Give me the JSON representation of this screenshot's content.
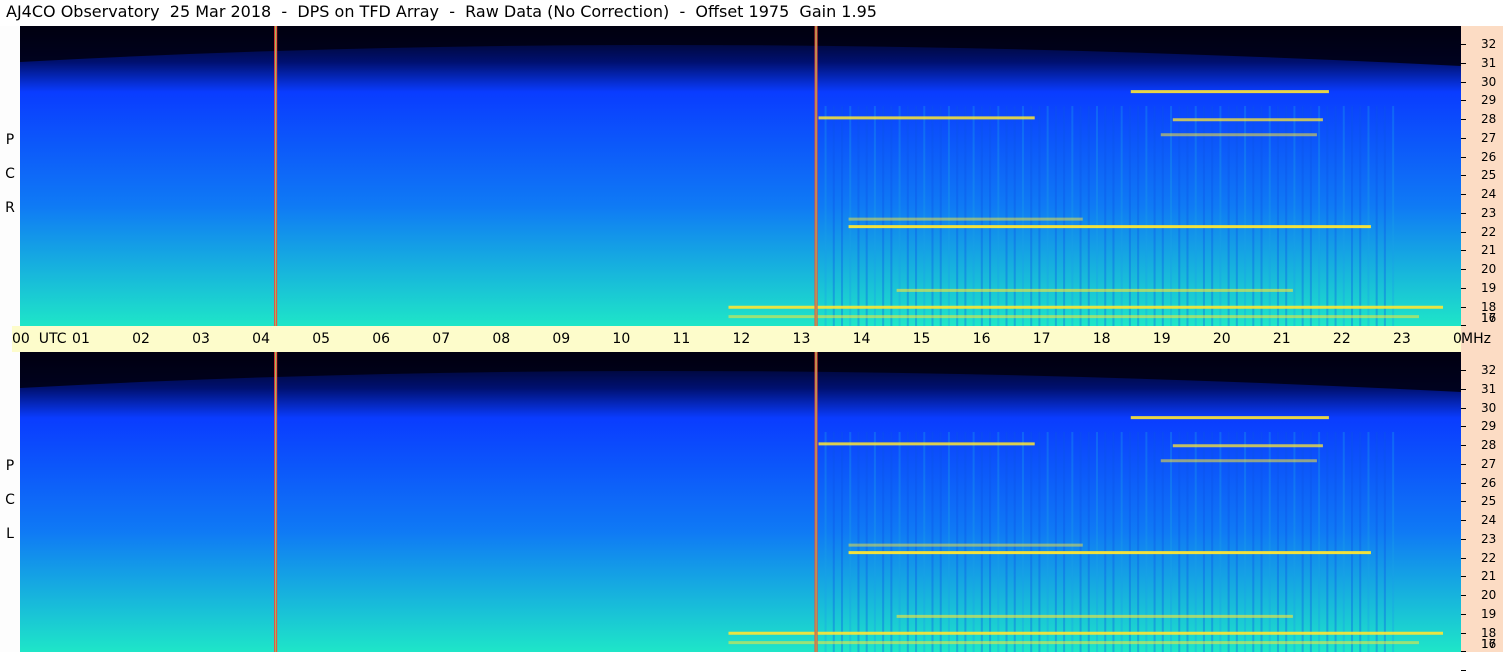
{
  "title": "AJ4CO Observatory  25 Mar 2018  -  DPS on TFD Array  -  Raw Data (No Correction)  -  Offset 1975  Gain 1.95",
  "panels": [
    {
      "label": [
        "R",
        "C",
        "P"
      ]
    },
    {
      "label": [
        "L",
        "C",
        "P"
      ]
    }
  ],
  "time_axis": {
    "labels": [
      "00  UTC",
      "01",
      "02",
      "03",
      "04",
      "05",
      "06",
      "07",
      "08",
      "09",
      "10",
      "11",
      "12",
      "13",
      "14",
      "15",
      "16",
      "17",
      "18",
      "19",
      "20",
      "21",
      "22",
      "23",
      "00"
    ],
    "unit": "MHz"
  },
  "freq_axis": {
    "labels": [
      "32",
      "31",
      "30",
      "29",
      "28",
      "27",
      "26",
      "25",
      "24",
      "23",
      "22",
      "21",
      "20",
      "19",
      "18",
      "17",
      "16"
    ]
  },
  "colors": {
    "spectrogram_low": "#000010",
    "spectrogram_mid": "#0a3cff",
    "spectrogram_high": "#1ee6c8",
    "signal": "#ffe633",
    "marker": "#ff3c3c",
    "time_axis_bg": "#fdfccb",
    "freq_axis_bg": "#fcdcc4"
  },
  "chart_data": {
    "type": "heatmap",
    "title": "AJ4CO Observatory  25 Mar 2018  -  DPS on TFD Array  -  Raw Data (No Correction)  -  Offset 1975  Gain 1.95",
    "xlabel": "UTC",
    "ylabel": "MHz",
    "xlim": [
      0,
      24
    ],
    "ylim": [
      16,
      32
    ],
    "x_ticks": [
      "00",
      "01",
      "02",
      "03",
      "04",
      "05",
      "06",
      "07",
      "08",
      "09",
      "10",
      "11",
      "12",
      "13",
      "14",
      "15",
      "16",
      "17",
      "18",
      "19",
      "20",
      "21",
      "22",
      "23",
      "00"
    ],
    "y_ticks": [
      32,
      31,
      30,
      29,
      28,
      27,
      26,
      25,
      24,
      23,
      22,
      21,
      20,
      19,
      18,
      17,
      16
    ],
    "panels": [
      "RCP",
      "LCP"
    ],
    "markers_utc": [
      4.25,
      13.25
    ],
    "bands_mhz": [
      {
        "freq": 28.5,
        "start": 18.5,
        "end": 21.8,
        "intensity": 0.9
      },
      {
        "freq": 27.1,
        "start": 13.3,
        "end": 16.9,
        "intensity": 0.85
      },
      {
        "freq": 27.0,
        "start": 19.2,
        "end": 21.7,
        "intensity": 0.75
      },
      {
        "freq": 26.2,
        "start": 19.0,
        "end": 21.6,
        "intensity": 0.55
      },
      {
        "freq": 21.7,
        "start": 13.8,
        "end": 17.7,
        "intensity": 0.5
      },
      {
        "freq": 21.3,
        "start": 13.8,
        "end": 22.5,
        "intensity": 0.95
      },
      {
        "freq": 17.9,
        "start": 14.6,
        "end": 21.2,
        "intensity": 0.6
      },
      {
        "freq": 17.0,
        "start": 11.8,
        "end": 23.7,
        "intensity": 0.9
      },
      {
        "freq": 16.5,
        "start": 11.8,
        "end": 23.3,
        "intensity": 0.55
      }
    ]
  }
}
